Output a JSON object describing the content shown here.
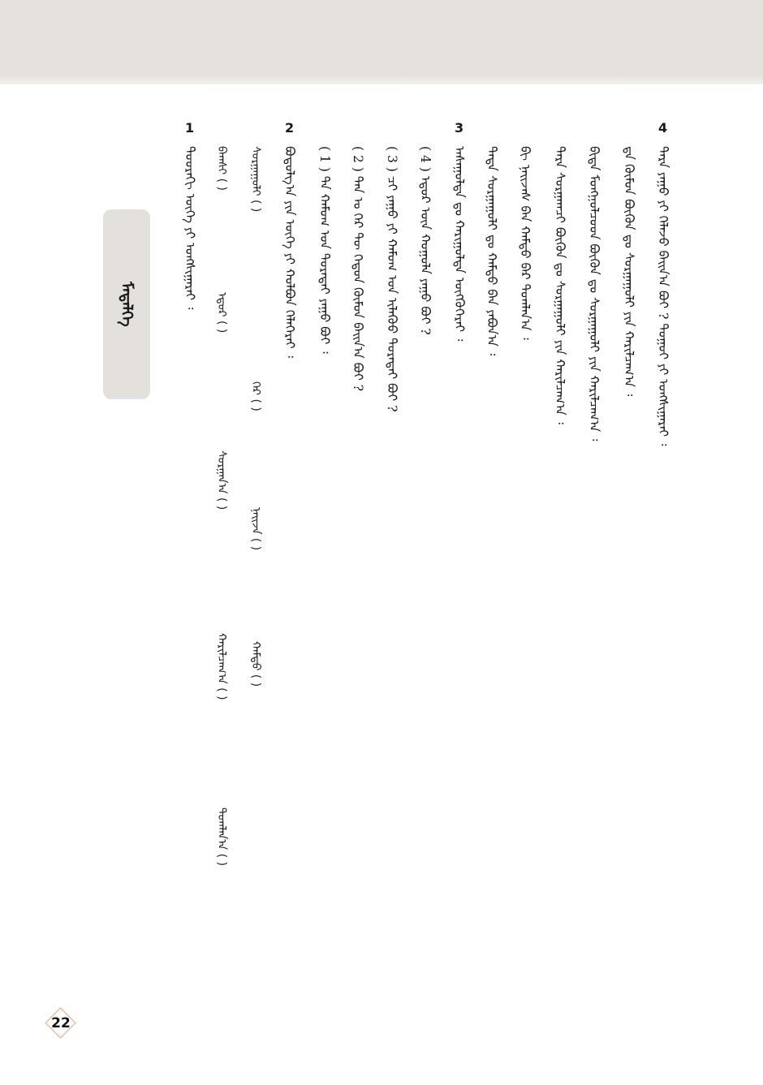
{
  "header": {
    "section_tab": "ᠮᠡᠳᠡᠯᠭᠡ"
  },
  "questions": [
    {
      "number": "4",
      "lines": [
        "ᠲᠡᠷᠡ ᠶᠠᠭᠤ ᠶᠢ ᠬᠡᠯᠡᠵᠦ ᠪᠠᠢᠨ᠎ᠠ ᠪᠤᠢ ? ᠳᠤᠭᠤᠶ ᠶᠢ ᠤᠩᠰᠢᠭᠠᠷᠠᠢ ᠄",
        "ᠳᠡ ᠬᠦᠮᠦᠨ ᠪᠦᠬᠦᠨ ᠳᠤ ᠰᠤᠷᠭᠠᠭᠤᠯᠢ ᠶᠢᠨ ᠬᠠᠷᠢᠯᠴᠠᠭ᠎ᠠ ᠄",
        "ᠪᠢᠳᠡ ᠮᠣᠩᠭᠣᠯᠴᠤᠳ ᠪᠦᠬᠦᠨ ᠳᠤ ᠰᠤᠷᠭᠠᠭᠤᠯᠢ ᠶᠢᠨ ᠬᠠᠷᠢᠯᠴᠠᠭ᠎ᠠ ᠄",
        "ᠲᠡᠷᠡ ᠰᠤᠷᠭᠠᠭᠴᠢ ᠪᠦᠬᠦᠨ ᠳᠤ ᠰᠤᠷᠭᠠᠭᠤᠯᠢ ᠶᠢᠨ ᠬᠠᠷᠢᠯᠴᠠᠭ᠎ᠠ ᠄",
        "ᠪᠢ ᠨᠠᠢᠵᠠᠰ ᠪᠠᠨ ᠬᠠᠮᠲᠤ ᠪᠡᠷ ᠲᠣᠭᠯᠠᠨ᠎ᠠ ᠄",
        "ᠲᠡᠳᠡ ᠰᠤᠷᠭᠠᠭᠤᠯᠢ ᠳᠤ ᠬᠠᠮᠲᠤ ᠪᠠᠨ ᠶᠠᠪᠤᠨ᠎ᠠ ᠄"
      ]
    },
    {
      "number": "3",
      "lines": [
        "ᠠᠰᠠᠭᠤᠯᠲᠠ ᠳᠤ ᠬᠠᠷᠢᠭᠤᠯᠲᠠ ᠥᠭᠭᠦᠭᠡᠷᠡᠢ ᠄",
        "( 4 ) ᠡᠳᠦᠷ ᠦᠨ ᠬᠣᠭᠣᠯᠠ ᠶᠠᠭᠤ ᠪᠤᠢ ?",
        "( 3 ) ᠴᠢ ᠶᠠᠭᠤ ᠶᠢ ᠬᠠᠮᠤᠭ ᠤᠨ ᠢᠯᠡᠭᠦᠦ ᠳᠤᠷᠠᠲᠠᠢ ᠪᠤᠢ ?",
        "( 2 ) ᠲᠠᠨ ᠤ ᠭᠡᠷ ᠲᠦ ᠬᠡᠳᠦᠨ ᠬᠦᠮᠦᠨ ᠪᠠᠢᠨ᠎ᠠ ᠪᠤᠢ ?",
        "( 1 ) ᠲᠠ ᠬᠠᠮᠤᠭ ᠤᠨ ᠳᠤᠷᠠᠲᠠᠢ ᠶᠠᠭᠤ ᠪᠤᠢ ᠄"
      ]
    },
    {
      "number": "2",
      "lines": [
        "ᠪᠣᠳᠣᠯᠭ᠎ᠠ ᠶᠢᠨ ᠦᠭᠡ ᠶᠢ ᠬᠣᠯᠪᠣᠨ ᠬᠡᠯᠡᠭᠡᠷᠡᠢ ᠄"
      ]
    },
    {
      "number": "1",
      "lines": [
        "ᠳᠣᠣᠷᠠᠬᠢ ᠦᠭᠡ ᠶᠢ ᠤᠩᠰᠢᠭᠠᠷᠠᠢ ᠄"
      ]
    }
  ],
  "word_rows": [
    [
      "ᠰᠤᠷᠭᠠᠭᠤᠯᠢ ( )",
      "ᠭᠡᠷ ( )",
      "ᠨᠠᠢᠵᠠ ( )",
      "ᠬᠠᠮᠲᠤ ( )"
    ],
    [
      "ᠪᠠᠭᠰᠢ ( )",
      "ᠡᠳᠦᠷ ( )",
      "ᠰᠤᠷᠭᠠᠨ᠎ᠠ ( )",
      "ᠬᠠᠷᠢᠯᠴᠠᠭ᠎ᠠ ( )",
      "ᠲᠣᠭᠯᠠᠨ᠎ᠠ ( )"
    ]
  ],
  "answer_blank": "(          )",
  "page_number": "22"
}
